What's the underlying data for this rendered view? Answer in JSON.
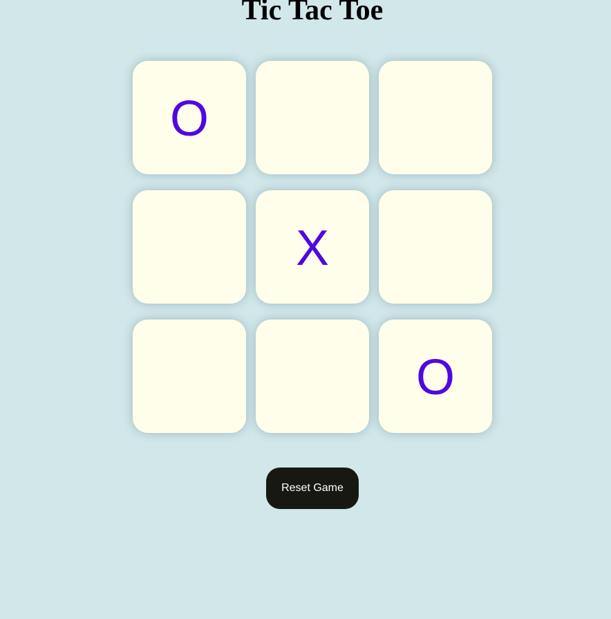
{
  "page": {
    "title": "Tic Tac Toe"
  },
  "board": {
    "cells": [
      {
        "row": 1,
        "col": 1,
        "value": "O"
      },
      {
        "row": 1,
        "col": 2,
        "value": ""
      },
      {
        "row": 1,
        "col": 3,
        "value": ""
      },
      {
        "row": 2,
        "col": 1,
        "value": ""
      },
      {
        "row": 2,
        "col": 2,
        "value": "X"
      },
      {
        "row": 2,
        "col": 3,
        "value": ""
      },
      {
        "row": 3,
        "col": 1,
        "value": ""
      },
      {
        "row": 3,
        "col": 2,
        "value": ""
      },
      {
        "row": 3,
        "col": 3,
        "value": "O"
      }
    ]
  },
  "controls": {
    "reset_label": "Reset Game"
  },
  "colors": {
    "background": "#d1e7ea",
    "cell": "#fffeea",
    "mark": "#5008e0",
    "button": "#181812",
    "button_text": "#ffffff"
  }
}
